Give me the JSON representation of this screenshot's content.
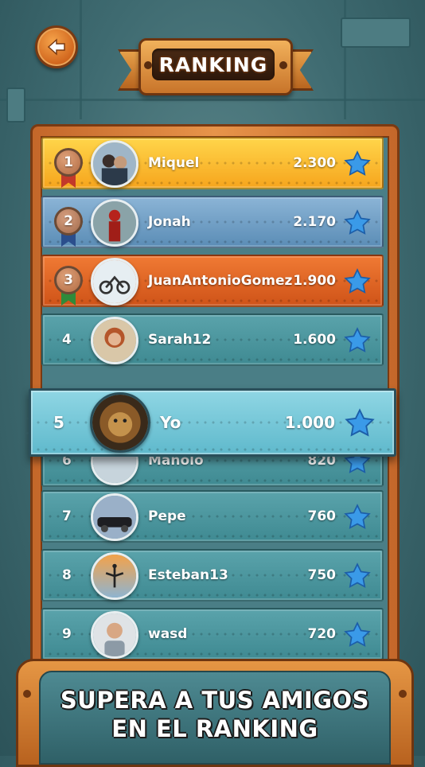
{
  "header": {
    "title": "RANKING",
    "back_icon": "arrow-left-icon"
  },
  "colors": {
    "gold_row": "#f6a51d",
    "silver_row": "#5b8db6",
    "bronze_row": "#cf5318",
    "teal_row": "#3f8a92",
    "me_row": "#5fb9cc",
    "star": "#3a9ae8",
    "wood": "#c4672a"
  },
  "ranking": [
    {
      "rank": "1",
      "name": "Miquel",
      "score": "2.300"
    },
    {
      "rank": "2",
      "name": "Jonah",
      "score": "2.170"
    },
    {
      "rank": "3",
      "name": "JuanAntonioGomez",
      "score": "1.900"
    },
    {
      "rank": "4",
      "name": "Sarah12",
      "score": "1.600"
    },
    {
      "rank": "5",
      "name": "Yo",
      "score": "1.000"
    },
    {
      "rank": "6",
      "name": "Manolo",
      "score": "820"
    },
    {
      "rank": "7",
      "name": "Pepe",
      "score": "760"
    },
    {
      "rank": "8",
      "name": "Esteban13",
      "score": "750"
    },
    {
      "rank": "9",
      "name": "wasd",
      "score": "720"
    }
  ],
  "banner": {
    "line1": "SUPERA A TUS AMIGOS",
    "line2": "EN EL RANKING"
  }
}
